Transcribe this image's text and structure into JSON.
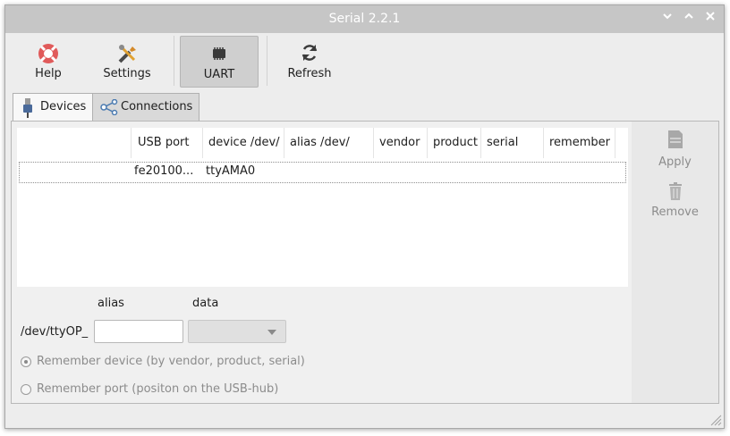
{
  "window": {
    "title": "Serial 2.2.1"
  },
  "titlebar_buttons": [
    "chevron-down-icon",
    "chevron-up-icon",
    "close-icon"
  ],
  "toolbar": {
    "help_label": "Help",
    "settings_label": "Settings",
    "uart_label": "UART",
    "refresh_label": "Refresh"
  },
  "tabs": [
    {
      "label": "Devices",
      "icon": "usb-plug-icon",
      "active": true
    },
    {
      "label": "Connections",
      "icon": "share-icon",
      "active": false
    }
  ],
  "table": {
    "columns": [
      "USB port",
      "device /dev/",
      "alias /dev/",
      "vendor",
      "product",
      "serial",
      "remember"
    ],
    "rows": [
      {
        "usb_port": "fe20100...",
        "device": "ttyAMA0",
        "alias": "",
        "vendor": "",
        "product": "",
        "serial": "",
        "remember": ""
      }
    ]
  },
  "sidebar": {
    "apply_label": "Apply",
    "remove_label": "Remove"
  },
  "form": {
    "alias_header": "alias",
    "data_header": "data",
    "prefix_label": "/dev/ttyOP_",
    "alias_value": "",
    "data_value": "",
    "radio_device_label": "Remember device (by vendor, product, serial)",
    "radio_port_label": "Remember port (positon on the USB-hub)",
    "radio_selected": "device"
  },
  "colors": {
    "titlebar": "#c6c6c6",
    "help_icon": "#e05050",
    "disabled_text": "#8c8c8c"
  }
}
